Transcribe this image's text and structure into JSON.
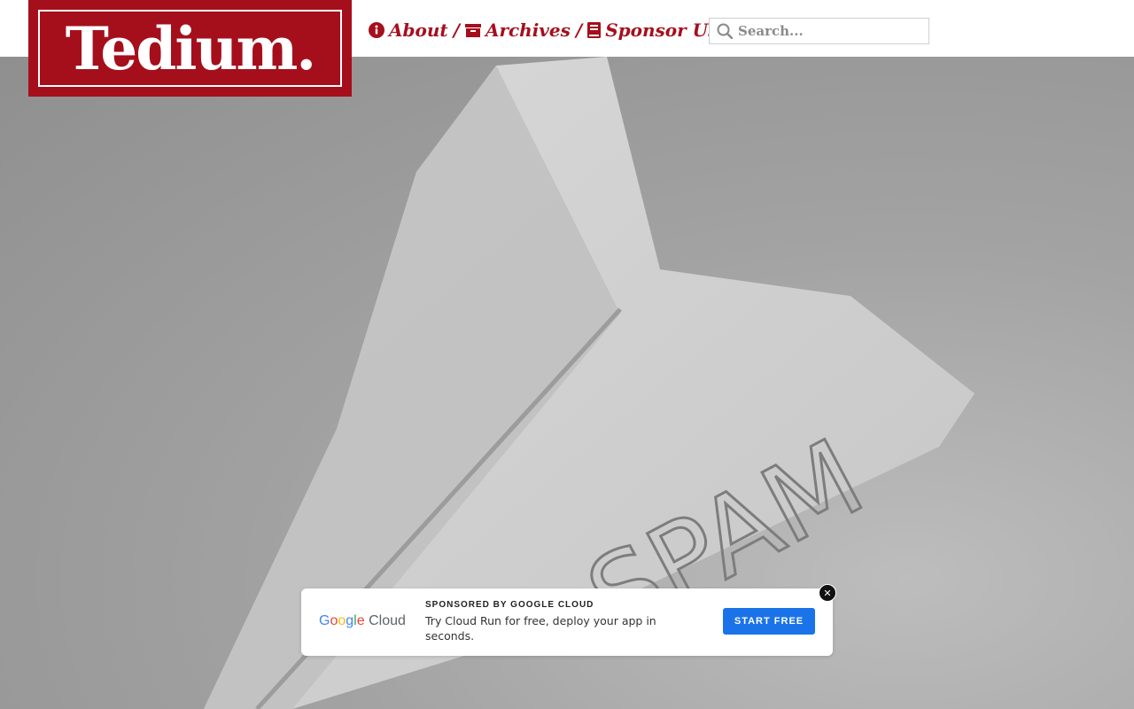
{
  "site": {
    "logo_text": "Tedium.",
    "brand_color": "#a50f1c"
  },
  "nav": {
    "items": [
      {
        "label": "About",
        "icon": "info-circle-icon"
      },
      {
        "label": "Archives",
        "icon": "archive-box-icon"
      },
      {
        "label": "Sponsor Us",
        "icon": "book-icon"
      }
    ],
    "separator": "/"
  },
  "search": {
    "placeholder": "Search...",
    "icon": "search-icon"
  },
  "hero": {
    "image_text": "SPAM"
  },
  "ad": {
    "brand_name": "Google Cloud",
    "sponsor_line": "SPONSORED BY GOOGLE CLOUD",
    "copy": "Try Cloud Run for free, deploy your app in seconds.",
    "cta_label": "START FREE",
    "close_label": "✕",
    "cta_color": "#1a73e8"
  }
}
